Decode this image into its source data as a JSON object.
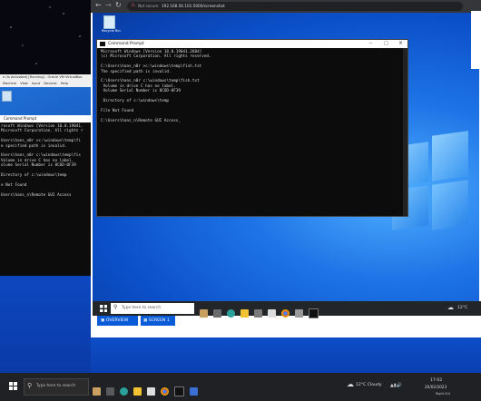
{
  "outer_vm": {
    "title": "e (Is Activated) [Running] - Oracle VM VirtualBox",
    "menu": [
      "Machine",
      "View",
      "Input",
      "Devices",
      "Help"
    ],
    "cmd_title": "Command Prompt",
    "cmd_lines": [
      "rosoft Windows [Version 10.0.19041.",
      "Microsoft Corporation. All rights r",
      "",
      "Users\\hans_n0r >c:\\windows\\temp\\fi",
      "e specified path is invalid.",
      "",
      "Users\\hans_n0r c:\\windows\\temp\\fis",
      "Volume in drive C has no label.",
      "olume Serial Number is 8C6D-0F39",
      "",
      "Directory of c:\\windows\\temp",
      "",
      "e Not Found",
      "",
      "Users\\hans_n\\Remote GUI Access"
    ]
  },
  "browser": {
    "security_label": "Not secure",
    "url": "192.168.56.101:5000/screenshot",
    "desktop_icon_label": "Recycle Bin",
    "cmd_title": "Command Prompt",
    "cmd_lines": [
      "Microsoft Windows [Version 10.0.19041.2604]",
      "(c) Microsoft Corporation. All rights reserved.",
      "",
      "C:\\Users\\hans_n0r >c:\\windows\\temp\\fish.txt",
      "The specified path is invalid.",
      "",
      "C:\\Users\\hans_n0r c:\\windows\\temp\\fish.txt",
      " Volume in drive C has no label.",
      " Volume Serial Number is 8C6D-0F39",
      "",
      " Directory of c:\\windows\\temp",
      "",
      "File Not Found",
      "",
      "C:\\Users\\hans_n\\Remote GUI Access_"
    ],
    "search_placeholder": "Type here to search",
    "weather": "12°C",
    "buttons": {
      "overview": "OVERVIEW",
      "screen1": "SCREEN 1"
    }
  },
  "host_taskbar": {
    "search_placeholder": "Type here to search",
    "weather": "12°C  Cloudy",
    "time": "17:02",
    "date": "20/02/2023",
    "right_ctrl": "Right Ctrl"
  },
  "colors": {
    "blue_accent": "#0a5bd8",
    "cmd_bg": "#0c0c0c",
    "taskbar": "#1f2124"
  }
}
